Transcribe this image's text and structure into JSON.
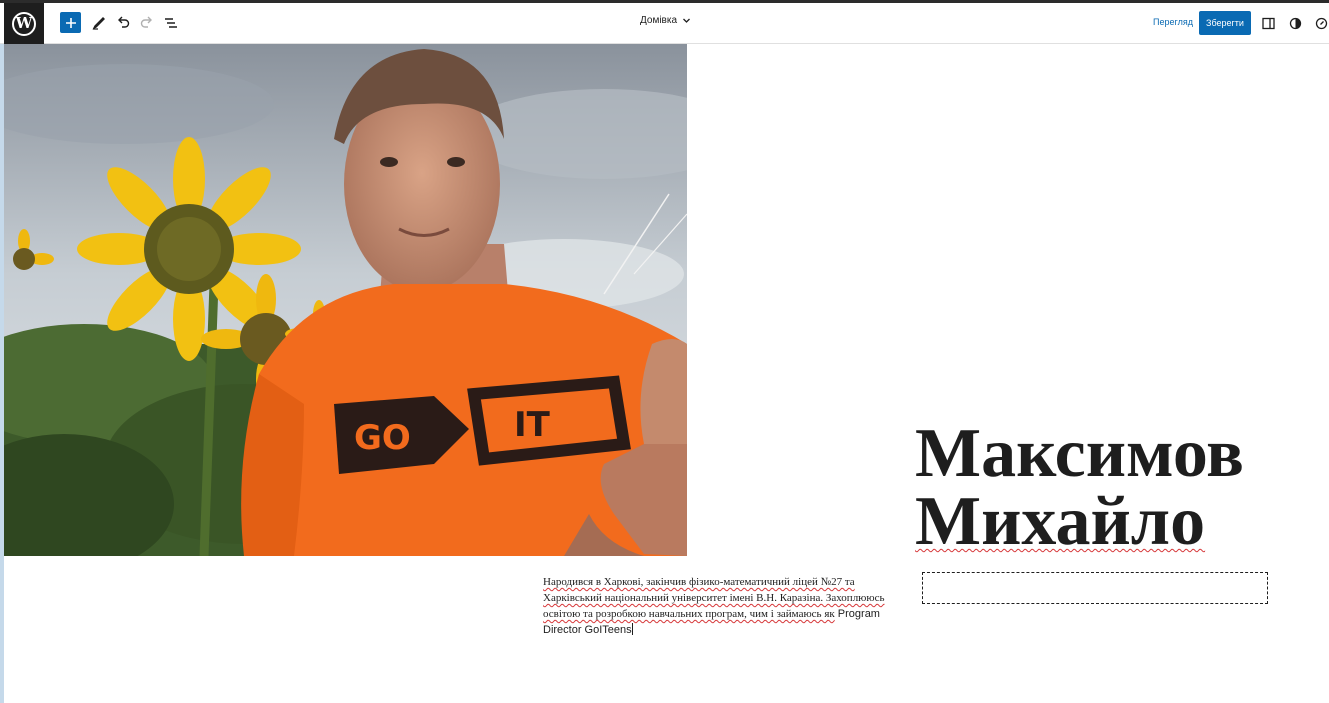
{
  "toolbar": {
    "document_title": "Домівка",
    "preview_label": "Перегляд",
    "save_label": "Зберегти",
    "icons": [
      "wordpress-logo",
      "add-block-icon",
      "pen-tool-icon",
      "undo-icon",
      "redo-icon",
      "list-view-icon",
      "chevron-down-icon",
      "sidebar-toggle-icon",
      "styles-contrast-icon",
      "compass-icon"
    ]
  },
  "content": {
    "image_text": "GO IT",
    "heading_line1": "Максимов",
    "heading_line2": "Михайло",
    "bio_parts": [
      "Народився в Харкові, закінчив фізико-математичний ліцей №27 та Харківський національний університет імені В.Н. Каразіна. Захоплююсь освітою та розробкою навчальних програм, чим і займаюсь як",
      " Program Director GoITeens"
    ]
  },
  "colors": {
    "accent": "#0a6ab3",
    "toolbar_dark": "#1e1e1e",
    "shirt_orange": "#f26b1d"
  }
}
